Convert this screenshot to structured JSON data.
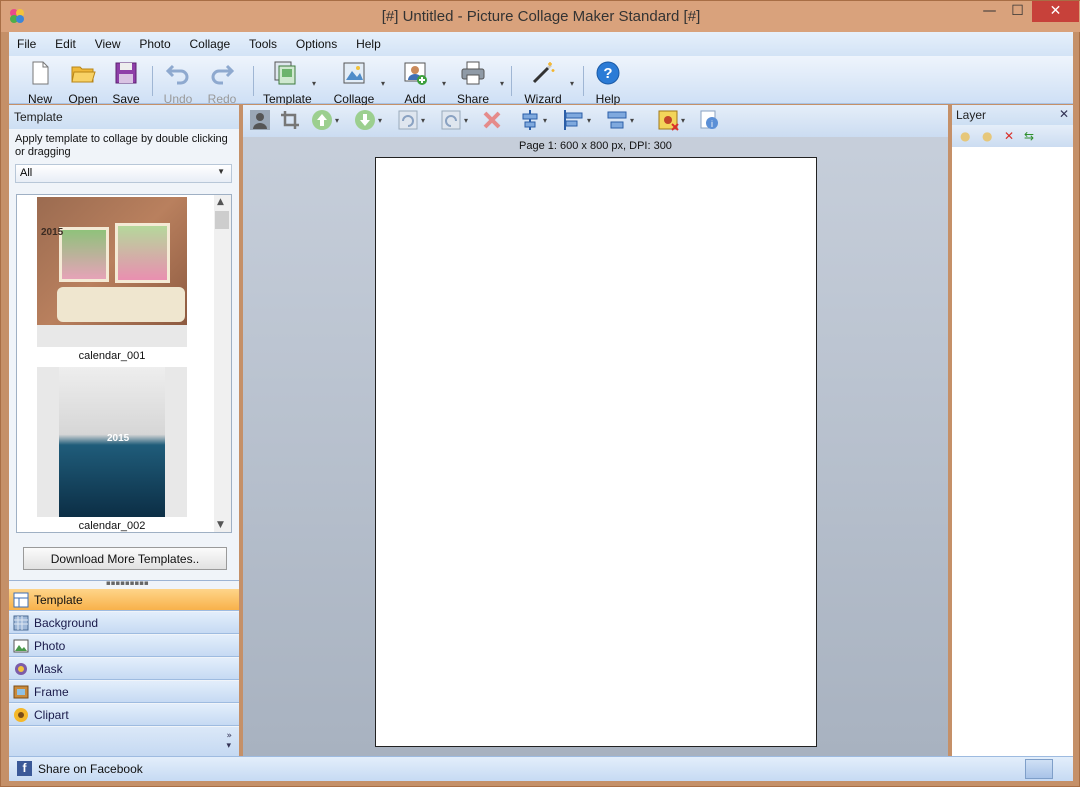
{
  "window": {
    "title": "[#] Untitled - Picture Collage Maker Standard [#]",
    "controls": {
      "minimize": "—",
      "maximize": "☐",
      "close": "✕"
    }
  },
  "menu": [
    "File",
    "Edit",
    "View",
    "Photo",
    "Collage",
    "Tools",
    "Options",
    "Help"
  ],
  "toolbar": {
    "new": "New",
    "open": "Open",
    "save": "Save",
    "undo": "Undo",
    "redo": "Redo",
    "template": "Template",
    "collage": "Collage",
    "add": "Add",
    "share": "Share",
    "wizard": "Wizard",
    "help": "Help"
  },
  "left_panel": {
    "header": "Template",
    "description": "Apply template to collage by double clicking or dragging",
    "filter_value": "All",
    "templates": [
      {
        "name": "calendar_001",
        "year": "2015"
      },
      {
        "name": "calendar_002",
        "year": "2015"
      }
    ],
    "download_button": "Download More Templates..",
    "nav": [
      "Template",
      "Background",
      "Photo",
      "Mask",
      "Frame",
      "Clipart"
    ],
    "active_nav": "Template"
  },
  "canvas": {
    "page_info": "Page 1: 600 x 800 px, DPI: 300"
  },
  "right_panel": {
    "header": "Layer"
  },
  "statusbar": {
    "share_facebook": "Share on Facebook"
  }
}
